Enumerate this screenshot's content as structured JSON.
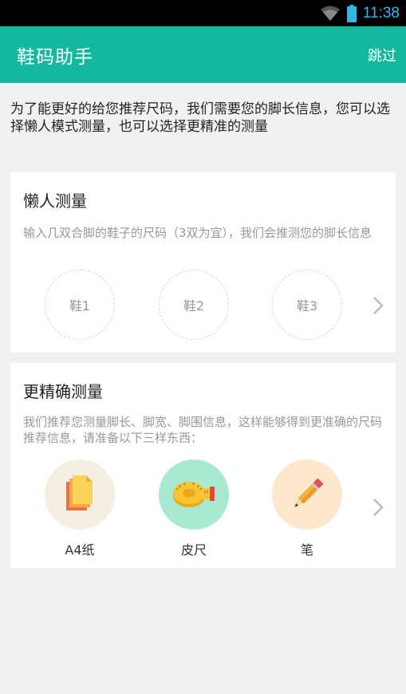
{
  "status_bar": {
    "time": "11:38",
    "time_color": "#33b5e5"
  },
  "app_bar": {
    "title": "鞋码助手",
    "skip_label": "跳过",
    "color": "#14b8a0"
  },
  "intro": {
    "text": "为了能更好的给您推荐尺码，我们需要您的脚长信息，您可以选择懒人模式测量，也可以选择更精准的测量"
  },
  "lazy_card": {
    "title": "懒人测量",
    "description": "输入几双合脚的鞋子的尺码（3双为宜），我们会推测您的脚长信息",
    "shoes": [
      "鞋1",
      "鞋2",
      "鞋3"
    ]
  },
  "precise_card": {
    "title": "更精确测量",
    "description": "我们推荐您测量脚长、脚宽、脚围信息，这样能够得到更准确的尺码推荐信息，请准备以下三样东西：",
    "tools": [
      {
        "label": "A4纸",
        "icon": "a4-paper-icon",
        "bg": "#f5efe3"
      },
      {
        "label": "皮尺",
        "icon": "tape-measure-icon",
        "bg": "#a8ead0"
      },
      {
        "label": "笔",
        "icon": "pencil-icon",
        "bg": "#fde8cd"
      }
    ]
  }
}
